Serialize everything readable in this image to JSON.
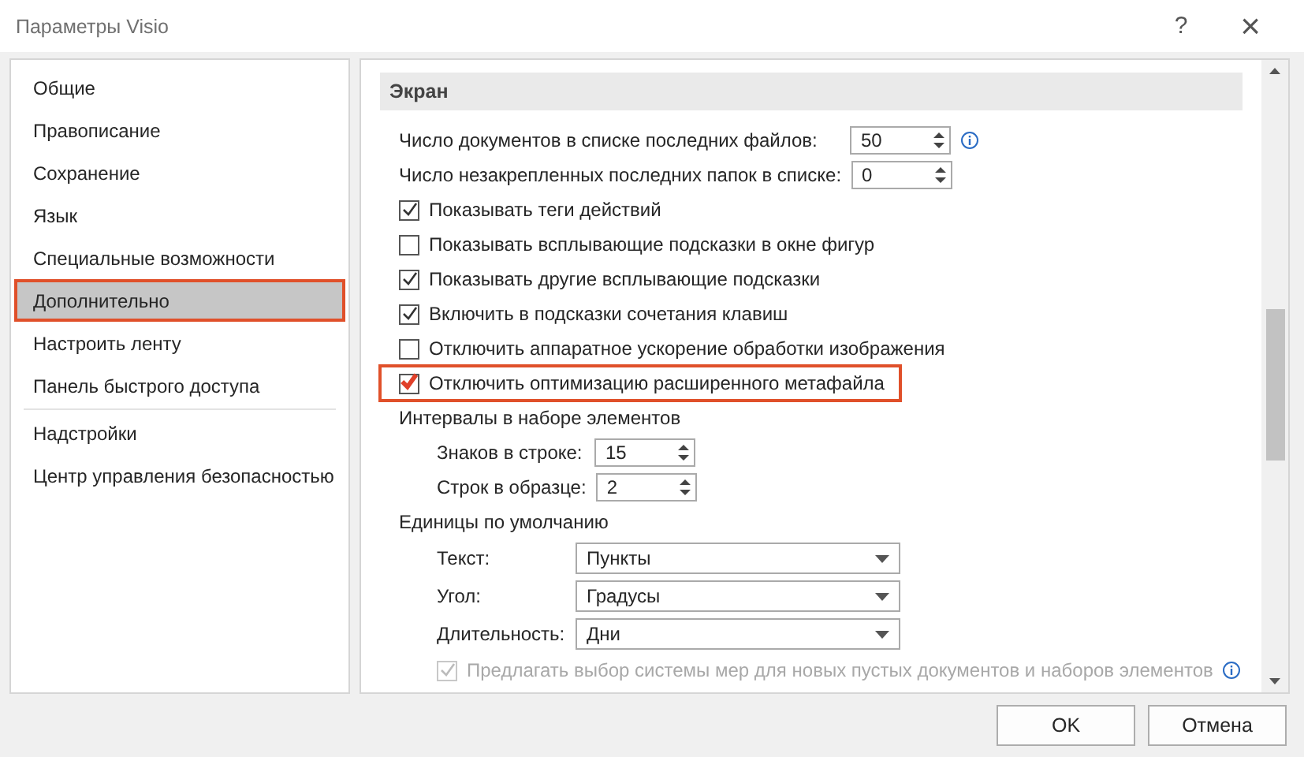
{
  "window": {
    "title": "Параметры Visio",
    "help": "?",
    "close": "×"
  },
  "sidebar": {
    "sections": [
      [
        {
          "label": "Общие",
          "selected": false,
          "highlighted": false
        },
        {
          "label": "Правописание",
          "selected": false,
          "highlighted": false
        },
        {
          "label": "Сохранение",
          "selected": false,
          "highlighted": false
        },
        {
          "label": "Язык",
          "selected": false,
          "highlighted": false
        },
        {
          "label": "Специальные возможности",
          "selected": false,
          "highlighted": false
        },
        {
          "label": "Дополнительно",
          "selected": true,
          "highlighted": true
        },
        {
          "label": "Настроить ленту",
          "selected": false,
          "highlighted": false
        },
        {
          "label": "Панель быстрого доступа",
          "selected": false,
          "highlighted": false
        }
      ],
      [
        {
          "label": "Надстройки",
          "selected": false,
          "highlighted": false
        },
        {
          "label": "Центр управления безопасностью",
          "selected": false,
          "highlighted": false
        }
      ]
    ]
  },
  "section": {
    "title": "Экран"
  },
  "items": [
    {
      "kind": "spin",
      "label": "Число документов в списке последних файлов:",
      "value": "50",
      "info": true
    },
    {
      "kind": "spin",
      "label": "Число незакрепленных последних папок в списке:",
      "value": "0"
    },
    {
      "kind": "check",
      "label": "Показывать теги действий",
      "checked": true,
      "disabled": false,
      "highlighted": false
    },
    {
      "kind": "check",
      "label": "Показывать всплывающие подсказки в окне фигур",
      "checked": false,
      "disabled": false,
      "highlighted": false
    },
    {
      "kind": "check",
      "label": "Показывать другие всплывающие подсказки",
      "checked": true,
      "disabled": false,
      "highlighted": false
    },
    {
      "kind": "check",
      "label": "Включить в подсказки сочетания клавиш",
      "checked": true,
      "disabled": false,
      "highlighted": false
    },
    {
      "kind": "check",
      "label": "Отключить аппаратное ускорение обработки изображения",
      "checked": false,
      "disabled": false,
      "highlighted": false
    },
    {
      "kind": "check",
      "label": "Отключить оптимизацию расширенного метафайла",
      "checked": true,
      "disabled": false,
      "highlighted": true
    },
    {
      "kind": "heading",
      "label": "Интервалы в наборе элементов"
    },
    {
      "kind": "subspin",
      "label": "Знаков в строке:",
      "value": "15"
    },
    {
      "kind": "subspin",
      "label": "Строк в образце:",
      "value": "2"
    },
    {
      "kind": "heading",
      "label": "Единицы по умолчанию"
    },
    {
      "kind": "select",
      "label": "Текст:",
      "value": "Пункты"
    },
    {
      "kind": "select",
      "label": "Угол:",
      "value": "Градусы"
    },
    {
      "kind": "select",
      "label": "Длительность:",
      "value": "Дни"
    },
    {
      "kind": "subcheck",
      "label": "Предлагать выбор системы мер для новых пустых документов и наборов элементов",
      "checked": true,
      "disabled": true,
      "highlighted": false,
      "info": true
    }
  ],
  "buttons": [
    "OK",
    "Отмена"
  ]
}
